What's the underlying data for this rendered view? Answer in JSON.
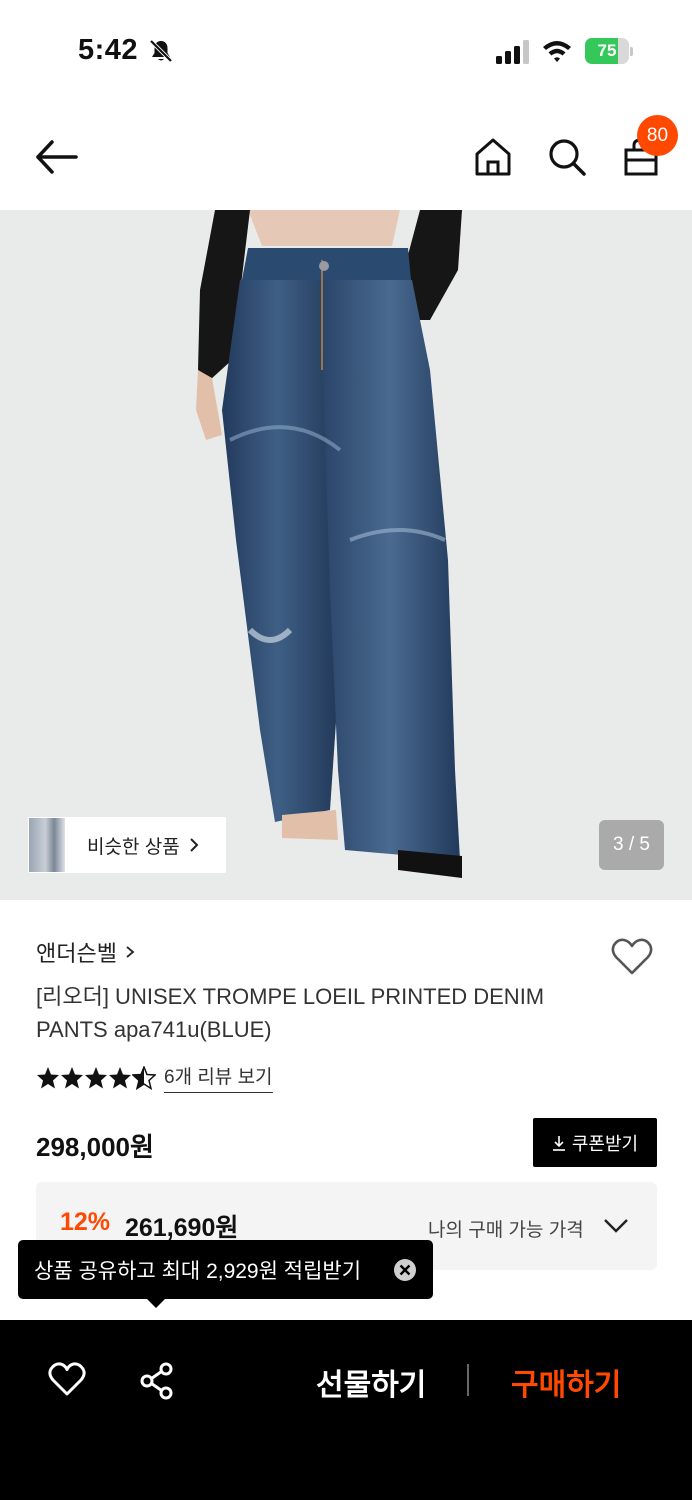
{
  "status_bar": {
    "time": "5:42",
    "battery_percent": 75,
    "battery_label": "75",
    "icons": [
      "bell-off-icon",
      "cellular-signal-icon",
      "wifi-icon",
      "battery-charging-icon"
    ]
  },
  "header": {
    "cart_count": "80",
    "icons": [
      "back-arrow-icon",
      "home-icon",
      "search-icon",
      "shopping-bag-icon"
    ]
  },
  "gallery": {
    "similar_label": "비슷한 상품",
    "counter": "3 / 5",
    "current_index": 3,
    "total": 5
  },
  "product": {
    "brand": "앤더슨벨",
    "title": "[리오더] UNISEX TROMPE LOEIL PRINTED DENIM PANTS apa741u(BLUE)",
    "rating": 4.5,
    "review_link": "6개 리뷰 보기",
    "price": "298,000원",
    "coupon_label": "쿠폰받기",
    "discount_rate": "12%",
    "discount_price": "261,690원",
    "my_price_label": "나의 구매 가능 가격"
  },
  "tooltip": {
    "text": "상품 공유하고 최대 2,929원 적립받기"
  },
  "bottom_bar": {
    "gift_label": "선물하기",
    "buy_label": "구매하기"
  },
  "colors": {
    "accent": "#ff4800",
    "bar_bg": "#000000",
    "battery_green": "#34c759"
  }
}
